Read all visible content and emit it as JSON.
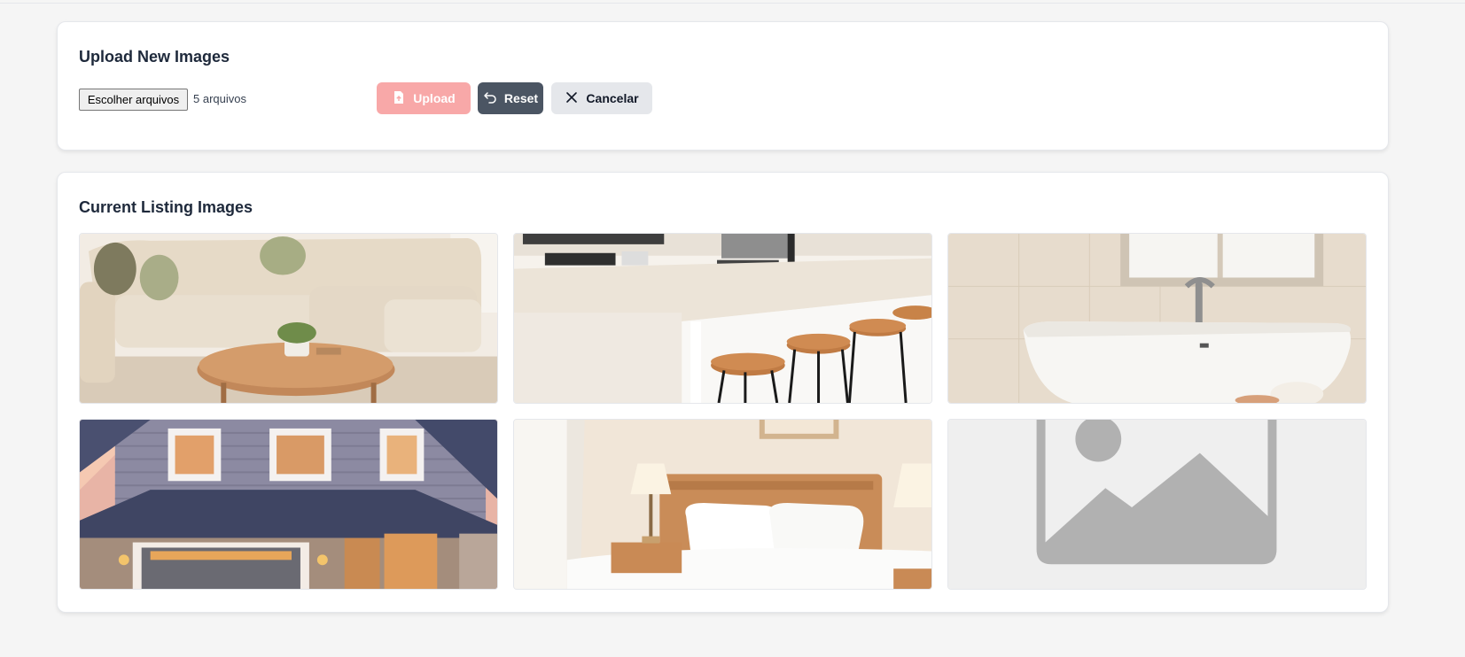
{
  "upload_section": {
    "title": "Upload New Images",
    "file_input": {
      "button_label": "Escolher arquivos",
      "selected_text": "5 arquivos"
    },
    "buttons": {
      "upload_label": "Upload",
      "reset_label": "Reset",
      "cancel_label": "Cancelar"
    }
  },
  "listing_section": {
    "title": "Current Listing Images",
    "images": [
      {
        "subject": "living-room-sofa"
      },
      {
        "subject": "kitchen-counter-stools"
      },
      {
        "subject": "bathroom-bathtub"
      },
      {
        "subject": "house-exterior-garage"
      },
      {
        "subject": "bedroom-bed-lamps"
      },
      {
        "subject": "placeholder-image-icon"
      }
    ]
  },
  "colors": {
    "upload_button_bg": "#f8a8a8",
    "reset_button_bg": "#4b5563",
    "cancel_button_bg": "#e5e7eb",
    "page_bg": "#f5f5f5"
  }
}
